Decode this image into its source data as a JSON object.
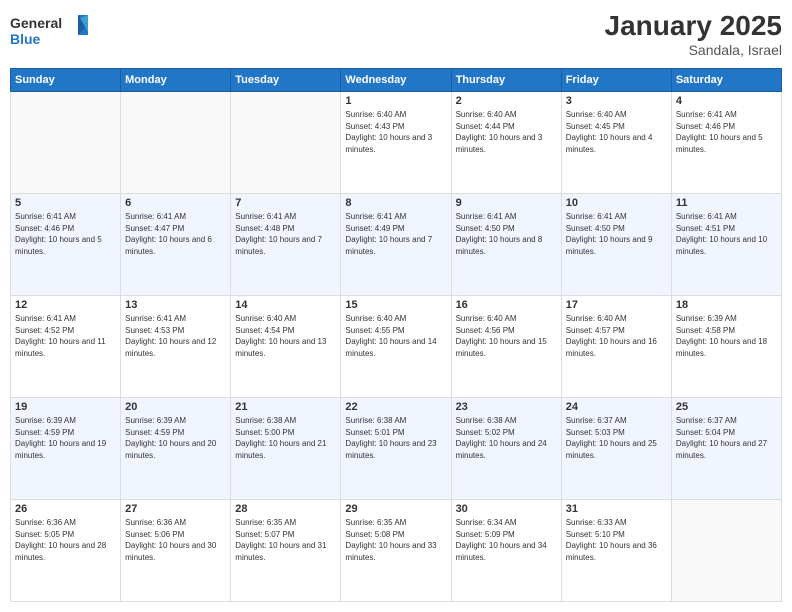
{
  "header": {
    "logo": {
      "line1": "General",
      "line2": "Blue"
    },
    "title": "January 2025",
    "location": "Sandala, Israel"
  },
  "days_header": [
    "Sunday",
    "Monday",
    "Tuesday",
    "Wednesday",
    "Thursday",
    "Friday",
    "Saturday"
  ],
  "weeks": [
    {
      "cells": [
        {
          "empty": true
        },
        {
          "empty": true
        },
        {
          "empty": true
        },
        {
          "day": 1,
          "sunrise": "6:40 AM",
          "sunset": "4:43 PM",
          "daylight": "10 hours and 3 minutes."
        },
        {
          "day": 2,
          "sunrise": "6:40 AM",
          "sunset": "4:44 PM",
          "daylight": "10 hours and 3 minutes."
        },
        {
          "day": 3,
          "sunrise": "6:40 AM",
          "sunset": "4:45 PM",
          "daylight": "10 hours and 4 minutes."
        },
        {
          "day": 4,
          "sunrise": "6:41 AM",
          "sunset": "4:46 PM",
          "daylight": "10 hours and 5 minutes."
        }
      ]
    },
    {
      "cells": [
        {
          "day": 5,
          "sunrise": "6:41 AM",
          "sunset": "4:46 PM",
          "daylight": "10 hours and 5 minutes."
        },
        {
          "day": 6,
          "sunrise": "6:41 AM",
          "sunset": "4:47 PM",
          "daylight": "10 hours and 6 minutes."
        },
        {
          "day": 7,
          "sunrise": "6:41 AM",
          "sunset": "4:48 PM",
          "daylight": "10 hours and 7 minutes."
        },
        {
          "day": 8,
          "sunrise": "6:41 AM",
          "sunset": "4:49 PM",
          "daylight": "10 hours and 7 minutes."
        },
        {
          "day": 9,
          "sunrise": "6:41 AM",
          "sunset": "4:50 PM",
          "daylight": "10 hours and 8 minutes."
        },
        {
          "day": 10,
          "sunrise": "6:41 AM",
          "sunset": "4:50 PM",
          "daylight": "10 hours and 9 minutes."
        },
        {
          "day": 11,
          "sunrise": "6:41 AM",
          "sunset": "4:51 PM",
          "daylight": "10 hours and 10 minutes."
        }
      ]
    },
    {
      "cells": [
        {
          "day": 12,
          "sunrise": "6:41 AM",
          "sunset": "4:52 PM",
          "daylight": "10 hours and 11 minutes."
        },
        {
          "day": 13,
          "sunrise": "6:41 AM",
          "sunset": "4:53 PM",
          "daylight": "10 hours and 12 minutes."
        },
        {
          "day": 14,
          "sunrise": "6:40 AM",
          "sunset": "4:54 PM",
          "daylight": "10 hours and 13 minutes."
        },
        {
          "day": 15,
          "sunrise": "6:40 AM",
          "sunset": "4:55 PM",
          "daylight": "10 hours and 14 minutes."
        },
        {
          "day": 16,
          "sunrise": "6:40 AM",
          "sunset": "4:56 PM",
          "daylight": "10 hours and 15 minutes."
        },
        {
          "day": 17,
          "sunrise": "6:40 AM",
          "sunset": "4:57 PM",
          "daylight": "10 hours and 16 minutes."
        },
        {
          "day": 18,
          "sunrise": "6:39 AM",
          "sunset": "4:58 PM",
          "daylight": "10 hours and 18 minutes."
        }
      ]
    },
    {
      "cells": [
        {
          "day": 19,
          "sunrise": "6:39 AM",
          "sunset": "4:59 PM",
          "daylight": "10 hours and 19 minutes."
        },
        {
          "day": 20,
          "sunrise": "6:39 AM",
          "sunset": "4:59 PM",
          "daylight": "10 hours and 20 minutes."
        },
        {
          "day": 21,
          "sunrise": "6:38 AM",
          "sunset": "5:00 PM",
          "daylight": "10 hours and 21 minutes."
        },
        {
          "day": 22,
          "sunrise": "6:38 AM",
          "sunset": "5:01 PM",
          "daylight": "10 hours and 23 minutes."
        },
        {
          "day": 23,
          "sunrise": "6:38 AM",
          "sunset": "5:02 PM",
          "daylight": "10 hours and 24 minutes."
        },
        {
          "day": 24,
          "sunrise": "6:37 AM",
          "sunset": "5:03 PM",
          "daylight": "10 hours and 25 minutes."
        },
        {
          "day": 25,
          "sunrise": "6:37 AM",
          "sunset": "5:04 PM",
          "daylight": "10 hours and 27 minutes."
        }
      ]
    },
    {
      "cells": [
        {
          "day": 26,
          "sunrise": "6:36 AM",
          "sunset": "5:05 PM",
          "daylight": "10 hours and 28 minutes."
        },
        {
          "day": 27,
          "sunrise": "6:36 AM",
          "sunset": "5:06 PM",
          "daylight": "10 hours and 30 minutes."
        },
        {
          "day": 28,
          "sunrise": "6:35 AM",
          "sunset": "5:07 PM",
          "daylight": "10 hours and 31 minutes."
        },
        {
          "day": 29,
          "sunrise": "6:35 AM",
          "sunset": "5:08 PM",
          "daylight": "10 hours and 33 minutes."
        },
        {
          "day": 30,
          "sunrise": "6:34 AM",
          "sunset": "5:09 PM",
          "daylight": "10 hours and 34 minutes."
        },
        {
          "day": 31,
          "sunrise": "6:33 AM",
          "sunset": "5:10 PM",
          "daylight": "10 hours and 36 minutes."
        },
        {
          "empty": true
        }
      ]
    }
  ]
}
